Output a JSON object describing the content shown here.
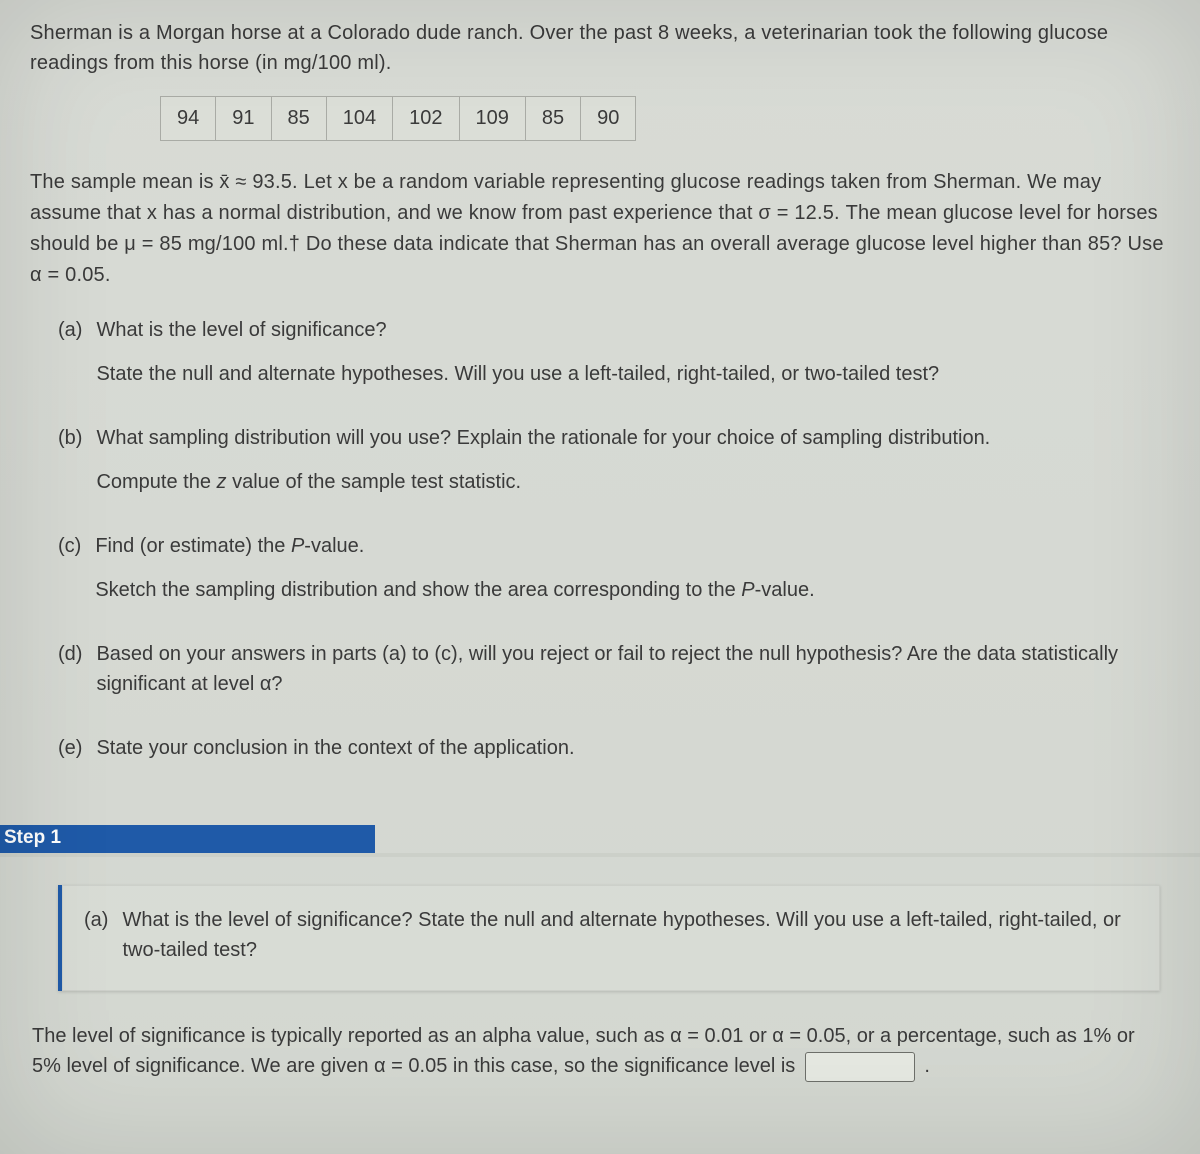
{
  "intro": "Sherman is a Morgan horse at a Colorado dude ranch. Over the past 8 weeks, a veterinarian took the following glucose readings from this horse (in mg/100 ml).",
  "readings": [
    "94",
    "91",
    "85",
    "104",
    "102",
    "109",
    "85",
    "90"
  ],
  "desc_html": "The sample mean is x̄ ≈ 93.5. Let x be a random variable representing glucose readings taken from Sherman. We may assume that x has a normal distribution, and we know from past experience that σ = 12.5. The mean glucose level for horses should be μ = 85 mg/100 ml.† Do these data indicate that Sherman has an overall average glucose level higher than 85? Use α = 0.05.",
  "qa": {
    "a_label": "(a)",
    "a_main": "What is the level of significance?",
    "a_sub": "State the null and alternate hypotheses. Will you use a left-tailed, right-tailed, or two-tailed test?",
    "b_label": "(b)",
    "b_main": "What sampling distribution will you use? Explain the rationale for your choice of sampling distribution.",
    "b_sub_pre": "Compute the ",
    "b_sub_z": "z",
    "b_sub_post": " value of the sample test statistic.",
    "c_label": "(c)",
    "c_main_pre": "Find (or estimate) the ",
    "c_main_p": "P",
    "c_main_post": "-value.",
    "c_sub_pre": "Sketch the sampling distribution and show the area corresponding to the ",
    "c_sub_p": "P",
    "c_sub_post": "-value.",
    "d_label": "(d)",
    "d_main": "Based on your answers in parts (a) to (c), will you reject or fail to reject the null hypothesis? Are the data statistically significant at level α?",
    "e_label": "(e)",
    "e_main": "State your conclusion in the context of the application."
  },
  "step_label": "Step 1",
  "step_box": {
    "label": "(a)",
    "text": "What is the level of significance? State the null and alternate hypotheses. Will you use a left-tailed, right-tailed, or two-tailed test?"
  },
  "explain_pre": "The level of significance is typically reported as an alpha value, such as α = 0.01 or α = 0.05, or a percentage, such as 1% or 5% level of significance. We are given α = 0.05 in this case, so the significance level is ",
  "explain_post": " .",
  "answer_value": ""
}
